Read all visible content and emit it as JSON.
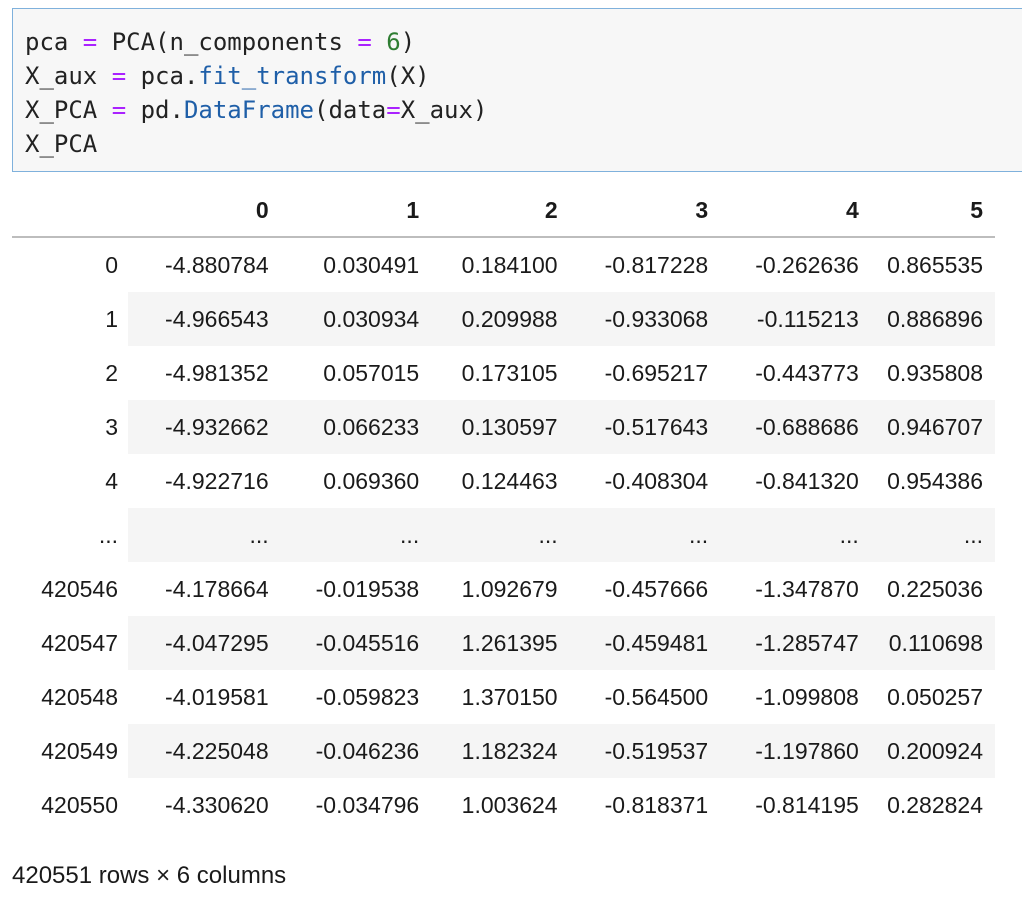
{
  "code_cell": {
    "lines": [
      {
        "tokens": [
          {
            "t": "pca ",
            "c": ""
          },
          {
            "t": "=",
            "c": "op"
          },
          {
            "t": " PCA(n_components ",
            "c": ""
          },
          {
            "t": "=",
            "c": "op"
          },
          {
            "t": " ",
            "c": ""
          },
          {
            "t": "6",
            "c": "num"
          },
          {
            "t": ")",
            "c": ""
          }
        ]
      },
      {
        "tokens": [
          {
            "t": "X_aux ",
            "c": ""
          },
          {
            "t": "=",
            "c": "op"
          },
          {
            "t": " pca.",
            "c": ""
          },
          {
            "t": "fit_transform",
            "c": "attr"
          },
          {
            "t": "(X)",
            "c": ""
          }
        ]
      },
      {
        "tokens": [
          {
            "t": "X_PCA ",
            "c": ""
          },
          {
            "t": "=",
            "c": "op"
          },
          {
            "t": " pd.",
            "c": ""
          },
          {
            "t": "DataFrame",
            "c": "attr"
          },
          {
            "t": "(data",
            "c": ""
          },
          {
            "t": "=",
            "c": "op"
          },
          {
            "t": "X_aux)",
            "c": ""
          }
        ]
      },
      {
        "tokens": [
          {
            "t": "X_PCA",
            "c": ""
          }
        ]
      }
    ]
  },
  "dataframe": {
    "columns": [
      "",
      "0",
      "1",
      "2",
      "3",
      "4",
      "5"
    ],
    "rows": [
      [
        "0",
        "-4.880784",
        "0.030491",
        "0.184100",
        "-0.817228",
        "-0.262636",
        "0.865535"
      ],
      [
        "1",
        "-4.966543",
        "0.030934",
        "0.209988",
        "-0.933068",
        "-0.115213",
        "0.886896"
      ],
      [
        "2",
        "-4.981352",
        "0.057015",
        "0.173105",
        "-0.695217",
        "-0.443773",
        "0.935808"
      ],
      [
        "3",
        "-4.932662",
        "0.066233",
        "0.130597",
        "-0.517643",
        "-0.688686",
        "0.946707"
      ],
      [
        "4",
        "-4.922716",
        "0.069360",
        "0.124463",
        "-0.408304",
        "-0.841320",
        "0.954386"
      ],
      [
        "...",
        "...",
        "...",
        "...",
        "...",
        "...",
        "..."
      ],
      [
        "420546",
        "-4.178664",
        "-0.019538",
        "1.092679",
        "-0.457666",
        "-1.347870",
        "0.225036"
      ],
      [
        "420547",
        "-4.047295",
        "-0.045516",
        "1.261395",
        "-0.459481",
        "-1.285747",
        "0.110698"
      ],
      [
        "420548",
        "-4.019581",
        "-0.059823",
        "1.370150",
        "-0.564500",
        "-1.099808",
        "0.050257"
      ],
      [
        "420549",
        "-4.225048",
        "-0.046236",
        "1.182324",
        "-0.519537",
        "-1.197860",
        "0.200924"
      ],
      [
        "420550",
        "-4.330620",
        "-0.034796",
        "1.003624",
        "-0.818371",
        "-0.814195",
        "0.282824"
      ]
    ],
    "shape_text": "420551 rows × 6 columns"
  },
  "colors": {
    "cell_border": "#7fb1dc",
    "operator": "#aa22ff",
    "number": "#2e7d32",
    "attribute": "#1f5fa8",
    "stripe": "#f5f5f5"
  }
}
